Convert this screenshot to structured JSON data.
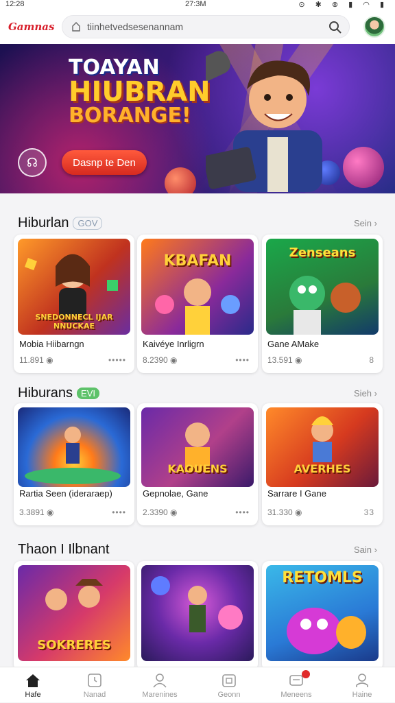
{
  "status": {
    "time": "12:28",
    "center_time": "27:3M",
    "icons": "⊙ ✱ ⊗ ▮ ◠ ▮"
  },
  "header": {
    "logo": "Gamnas",
    "search_value": "tiinhetvedsesenannam"
  },
  "hero": {
    "title_lines": [
      "TOAYAN",
      "HIUBRAN",
      "BORANGE!"
    ],
    "cta_label": "Dasnp te Den"
  },
  "sections": [
    {
      "title": "Hiburlan",
      "badge": "GOV",
      "badge_color": "#8a9bb0",
      "see_all": "Sein",
      "cards": [
        {
          "name": "Mobia Hiibarngn",
          "count": "11.891",
          "thumb_label": "SNEDONNECL IJAR NNUCKAE",
          "extra": "•••••"
        },
        {
          "name": "Kaivéye Inrligrn",
          "count": "8.2390",
          "thumb_label": "KBAFAN",
          "extra": "••••"
        },
        {
          "name": "Gane AMake",
          "count": "13.591",
          "thumb_label": "Zenseans",
          "extra": "8"
        }
      ]
    },
    {
      "title": "Hiburans",
      "badge": "EVI",
      "badge_color": "#3ea64b",
      "see_all": "Sieh",
      "cards": [
        {
          "name": "Rartia Seen (ideraraep)",
          "count": "3.3891",
          "thumb_label": "",
          "extra": "••••"
        },
        {
          "name": "Gepnolae, Gane",
          "count": "2.3390",
          "thumb_label": "KAOUENS",
          "extra": "••••"
        },
        {
          "name": "Sarrare I Gane",
          "count": "31.330",
          "thumb_label": "AVERHES",
          "extra": "33"
        }
      ]
    },
    {
      "title": "Thaon I Ilbnant",
      "badge": "",
      "badge_color": "",
      "see_all": "Sain",
      "cards": [
        {
          "name": "",
          "count": "",
          "thumb_label": "SOKRERES",
          "extra": ""
        },
        {
          "name": "",
          "count": "",
          "thumb_label": "",
          "extra": ""
        },
        {
          "name": "",
          "count": "",
          "thumb_label": "RETOMLS",
          "extra": ""
        }
      ]
    }
  ],
  "bottom_nav": [
    {
      "label": "Hafe",
      "icon": "home-icon"
    },
    {
      "label": "Nanad",
      "icon": "clock-square-icon"
    },
    {
      "label": "Marenines",
      "icon": "person-icon"
    },
    {
      "label": "Geonn",
      "icon": "calendar-icon"
    },
    {
      "label": "Meneens",
      "icon": "message-icon"
    },
    {
      "label": "Haine",
      "icon": "profile-icon"
    }
  ]
}
